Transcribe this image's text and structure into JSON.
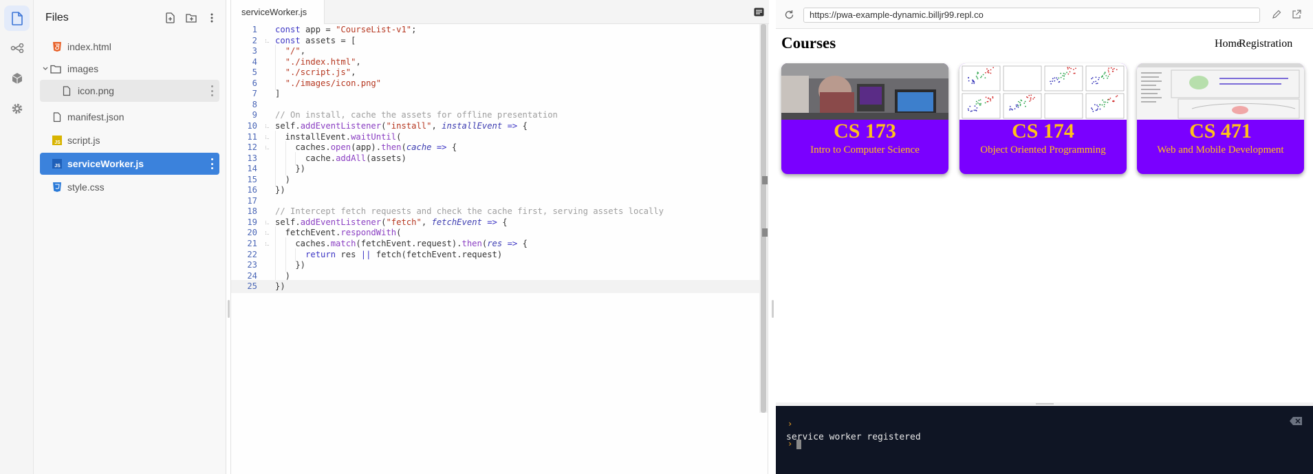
{
  "activity_bar": {
    "items": [
      {
        "name": "files",
        "icon": "file-icon",
        "active": true
      },
      {
        "name": "git",
        "icon": "git-icon",
        "active": false
      },
      {
        "name": "packages",
        "icon": "package-icon",
        "active": false
      },
      {
        "name": "settings",
        "icon": "gear-icon",
        "active": false
      }
    ]
  },
  "files_panel": {
    "title": "Files",
    "items": [
      {
        "label": "index.html",
        "icon": "html-icon",
        "depth": 0
      },
      {
        "label": "images",
        "icon": "folder-icon",
        "depth": 0,
        "expanded": true
      },
      {
        "label": "icon.png",
        "icon": "file-icon",
        "depth": 1
      },
      {
        "label": "manifest.json",
        "icon": "file-icon",
        "depth": 0
      },
      {
        "label": "script.js",
        "icon": "js-icon",
        "depth": 0
      },
      {
        "label": "serviceWorker.js",
        "icon": "js-icon",
        "depth": 0,
        "selected": true
      },
      {
        "label": "style.css",
        "icon": "css-icon",
        "depth": 0
      }
    ]
  },
  "editor": {
    "tab_label": "serviceWorker.js",
    "current_line": 25,
    "lines": [
      "const app = \"CourseList-v1\";",
      "const assets = [",
      "  \"/\",",
      "  \"./index.html\",",
      "  \"./script.js\",",
      "  \"./images/icon.png\"",
      "]",
      "",
      "// On install, cache the assets for offline presentation",
      "self.addEventListener(\"install\", installEvent => {",
      "  installEvent.waitUntil(",
      "    caches.open(app).then(cache => {",
      "      cache.addAll(assets)",
      "    })",
      "  )",
      "})",
      "",
      "// Intercept fetch requests and check the cache first, serving assets locally",
      "self.addEventListener(\"fetch\", fetchEvent => {",
      "  fetchEvent.respondWith(",
      "    caches.match(fetchEvent.request).then(res => {",
      "      return res || fetch(fetchEvent.request)",
      "    })",
      "  )",
      "})"
    ]
  },
  "webview": {
    "url": "https://pwa-example-dynamic.billjr99.repl.co",
    "site_title": "Courses",
    "nav": [
      "Home",
      "Registration"
    ],
    "courses": [
      {
        "code": "CS 173",
        "name": "Intro to Computer Science"
      },
      {
        "code": "CS 174",
        "name": "Object Oriented Programming"
      },
      {
        "code": "CS 471",
        "name": "Web and Mobile Development"
      }
    ]
  },
  "console": {
    "output": "service worker registered",
    "prompt": "›"
  },
  "colors": {
    "selected_file": "#3b82dc",
    "card_purple": "#7a00ff",
    "card_gold": "#ffc21a",
    "console_bg": "#0f1524"
  }
}
